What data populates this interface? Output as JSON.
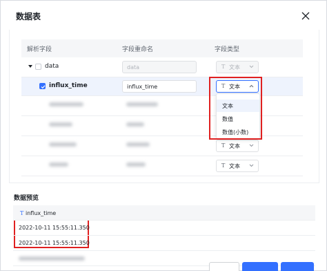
{
  "dialog": {
    "title": "数据表"
  },
  "table": {
    "headers": {
      "field": "解析字段",
      "rename": "字段重命名",
      "type": "字段类型"
    },
    "parent": {
      "name": "data",
      "rename": "data",
      "type": "文本"
    },
    "selected": {
      "name": "influx_time",
      "rename": "influx_time",
      "type": "文本",
      "checked": true
    },
    "blurred_rows": [
      {
        "type": ""
      },
      {
        "type": ""
      },
      {
        "type": "文本"
      },
      {
        "type": "文本"
      }
    ]
  },
  "type_icon": "T",
  "dropdown": {
    "options": [
      "文本",
      "数值",
      "数值(小数)"
    ],
    "selected_index": 0
  },
  "preview": {
    "title": "数据预览",
    "column": "influx_time",
    "rows": [
      "2022-10-11 15:55:11.350",
      "2022-10-11 15:55:11.350"
    ]
  },
  "colors": {
    "accent": "#3370ff",
    "highlight": "#e02020"
  }
}
